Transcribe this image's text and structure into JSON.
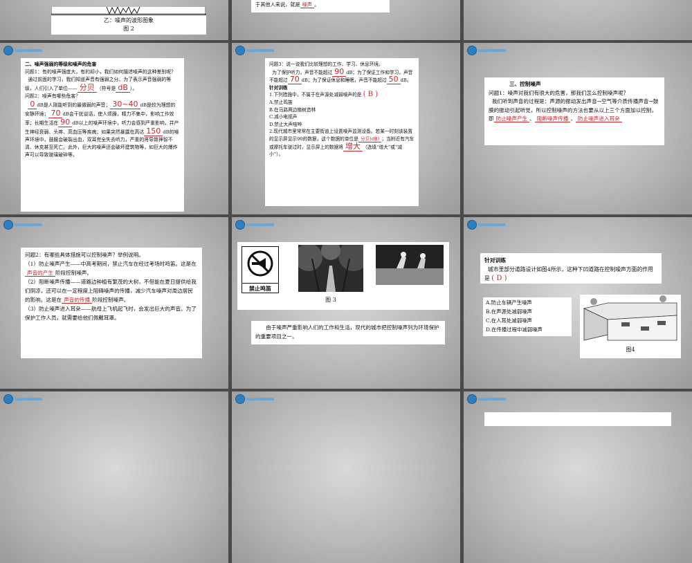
{
  "slide1": {
    "caption": "乙：噪声的波形图象",
    "figure": "图 2"
  },
  "slide2": {
    "text_prefix": "于其他人来说，就是",
    "answer": "噪声",
    "text_suffix": "。"
  },
  "slide4": {
    "heading": "二、噪声强弱的等级和噪声的危害",
    "q1": "问题1：有的噪声强度大，有的却小，我们如何描述噪声的这种差别呢？",
    "p1a": "通过前面的学习，我们知道声音有强弱之分。为了表示声音强弱的等级，人们引入了单位——",
    "a_unit": "分贝",
    "p1b": "（符号是",
    "a_symbol": "dB",
    "p1c": "）。",
    "q2": "问题2：噪声有哪些危害？",
    "a_zero": "0",
    "p2a": "dB是人刚能听到的最微弱的声音；",
    "a_range1": "30~40",
    "p2b": "dB是较为理想的安静环境；",
    "a_70": "70",
    "p2c": "dB会干扰谈话，使人烦躁，精力不集中，影响工作效率；长期生活在",
    "a_90": "90",
    "p2d": "dB以上的噪声环境中，听力会感到严重影响，并产生神经衰弱、头疼、高血压等疾病；如果突然暴露在高达",
    "a_150": "150",
    "p2e": "dB的噪声环境中，鼓膜会破裂出血，双耳完全失去听力，严重的将导致神智不清、休克甚至死亡。此外，巨大的噪声还会破坏建筑物等，如巨大的爆炸声可以导致玻璃破碎等。"
  },
  "slide5": {
    "q3": "问题3：说一说我们比较理想的工作、学习、休息环境。",
    "p_a": "为了保护听力，声音不能超过",
    "a1": "90",
    "p_b": "dB；为了保证工作和学习，声音不能超过",
    "a2": "70",
    "p_c": "dB；为了保证休息和睡眠，声音不能超过",
    "a3": "50",
    "p_d": "dB。",
    "training": "针对训练",
    "ex1": "1.下列措施中，不属于在声源处减弱噪声的是",
    "ex1_ans": "B",
    "optA": "A.禁止鸣笛",
    "optB": "B.在马路两边植树造林",
    "optC": "C.减小电视声",
    "optD": "D.禁止大声喧哗",
    "ex2a": "2.现代城市里常常在主要街道上设置噪声监测设备。若某一时刻该装置的显示屏显示90的数据，这个数据的单位是",
    "ex2_ans1": "分贝(dB)",
    "ex2b": "；当附近有汽车或摩托车驶过时，显示屏上的数据将",
    "ex2_ans2": "增大",
    "ex2c": "（选填“增大”或“减小”）。"
  },
  "slide6": {
    "heading": "三、控制噪声",
    "q1": "问题1：噪声对我们有很大的危害，那我们怎么控制噪声呢？",
    "body": "我们听到声音的过程是：声源的振动发出声音→空气等介质传播声音→鼓膜的振动引起听觉，所以控制噪声的方法也要从以上三个方面加以控制，即",
    "a1": "防止噪声产生",
    "a2": "阻断噪声传播",
    "a3": "防止噪声进入耳朵",
    "sep": "、"
  },
  "slide7": {
    "q2": "问题2：有哪些具体措施可以控制噪声？举例说明。",
    "p1a": "（1）防止噪声产生——中高考期间，禁止汽车在经过考场时鸣笛。这是在",
    "a1": "声音的产生",
    "p1b": "阶段控制噪声。",
    "p2a": "（2）阻断噪声传播——道路边种植有繁茂的大树，不但能在夏日提供给我们阴凉，还可以在一定程度上阻碍噪声的传播，减少汽车噪声对周边居民的影响。这是在",
    "a2": "声音的传播",
    "p2b": "阶段控制噪声。",
    "p3": "（3）防止噪声进入耳朵——航母上飞机起飞时，会发出巨大的声音。为了保护工作人员，就需要给他们佩戴耳罩。"
  },
  "slide8": {
    "sign_label": "禁止鸣笛",
    "figure": "图 3",
    "text": "由于噪声严重影响人们的工作和生活，现代的城市把控制噪声列为环境保护的重要项目之一。"
  },
  "slide9": {
    "training": "针对训练",
    "question": "城市里部分道路设计如图4所示，这种下凹道路在控制噪声方面的作用是",
    "answer": "D",
    "optA": "A.防止车辆产生噪声",
    "optB": "B.在声源处减弱噪声",
    "optC": "C.在人耳处减弱噪声",
    "optD": "D.在传播过程中减弱噪声",
    "figure": "图4"
  }
}
